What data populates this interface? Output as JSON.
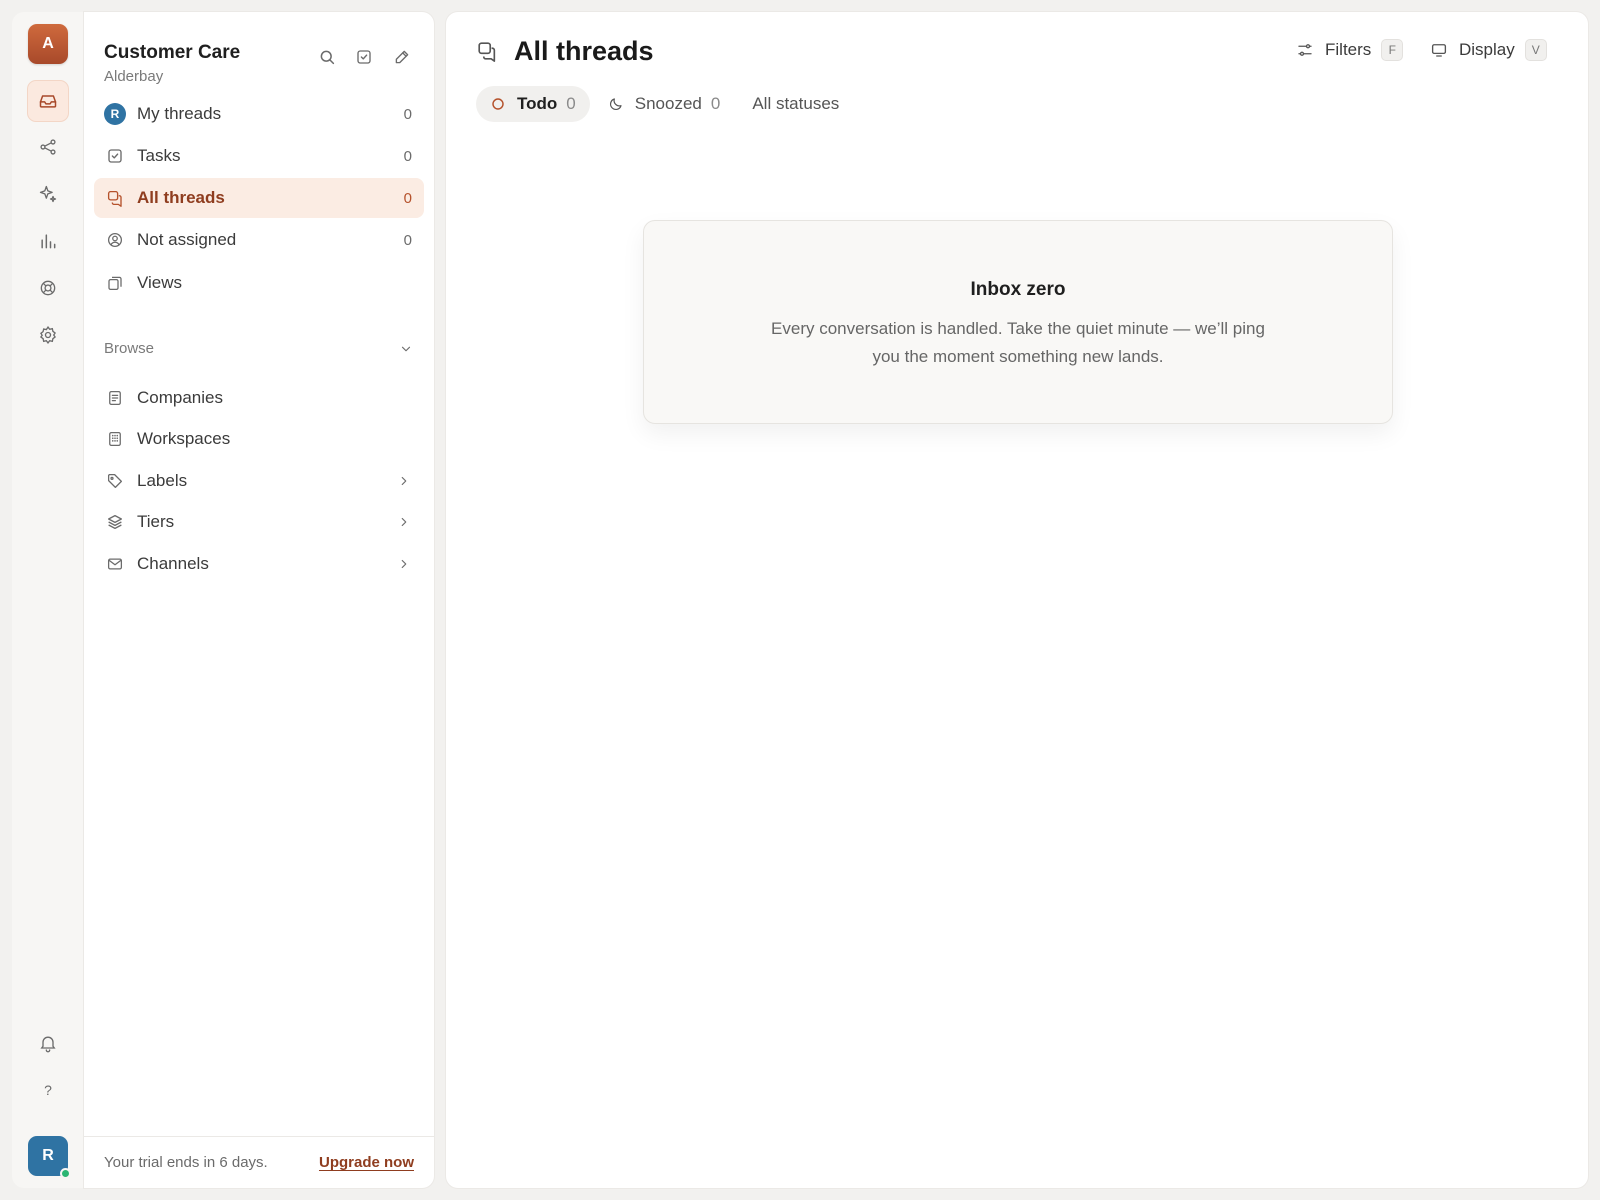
{
  "rail": {
    "org_initial": "A",
    "user_initial": "R",
    "help_glyph": "?",
    "icons": [
      "inbox-icon",
      "share-icon",
      "sparkles-icon",
      "bar-chart-icon",
      "lifebuoy-icon",
      "gear-icon",
      "bell-icon",
      "help-icon"
    ]
  },
  "sidebar": {
    "workspace_name": "Customer Care",
    "workspace_sub": "Alderbay",
    "user_initial": "R",
    "nav": [
      {
        "label": "My threads",
        "count": "0",
        "icon": "avatar"
      },
      {
        "label": "Tasks",
        "count": "0",
        "icon": "checkbox-icon"
      },
      {
        "label": "All threads",
        "count": "0",
        "icon": "threads-icon",
        "active": true
      },
      {
        "label": "Not assigned",
        "count": "0",
        "icon": "user-circle-icon"
      },
      {
        "label": "Views",
        "count": "",
        "icon": "views-icon"
      }
    ],
    "browse_title": "Browse",
    "browse": [
      {
        "label": "Companies",
        "icon": "document-icon"
      },
      {
        "label": "Workspaces",
        "icon": "building-icon"
      },
      {
        "label": "Labels",
        "icon": "tag-icon",
        "chevron": true
      },
      {
        "label": "Tiers",
        "icon": "layers-icon",
        "chevron": true
      },
      {
        "label": "Channels",
        "icon": "mail-icon",
        "chevron": true
      }
    ],
    "trial_text": "Your trial ends in 6 days.",
    "upgrade_label": "Upgrade now"
  },
  "main": {
    "title": "All threads",
    "filters_label": "Filters",
    "filters_key": "F",
    "display_label": "Display",
    "display_key": "V",
    "tabs": [
      {
        "label": "Todo",
        "count": "0"
      },
      {
        "label": "Snoozed",
        "count": "0"
      },
      {
        "label": "All statuses",
        "count": ""
      }
    ],
    "empty_title": "Inbox zero",
    "empty_desc": "Every conversation is handled. Take the quiet minute — we’ll ping you the moment something new lands."
  },
  "colors": {
    "accent": "#b5522c",
    "accent_bg": "#fbece3",
    "user_avatar": "#2f73a3",
    "online": "#2bb673"
  }
}
